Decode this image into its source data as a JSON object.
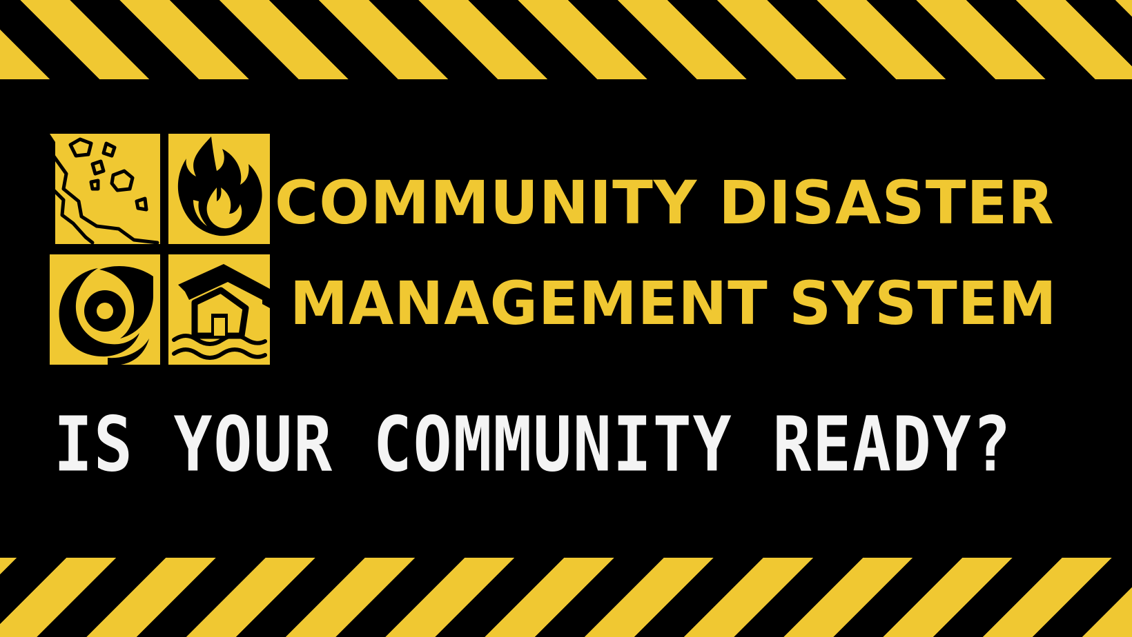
{
  "banner": {
    "title_line_1": "COMMUNITY DISASTER",
    "title_line_2": "MANAGEMENT SYSTEM",
    "tagline": "IS YOUR COMMUNITY READY?"
  },
  "colors": {
    "hazard_yellow": "#f0c832",
    "background": "#000000",
    "tagline_text": "#f4f4f4"
  },
  "icons": {
    "top_left": "landslide-icon",
    "top_right": "fire-icon",
    "bottom_left": "hurricane-icon",
    "bottom_right": "flood-icon"
  }
}
